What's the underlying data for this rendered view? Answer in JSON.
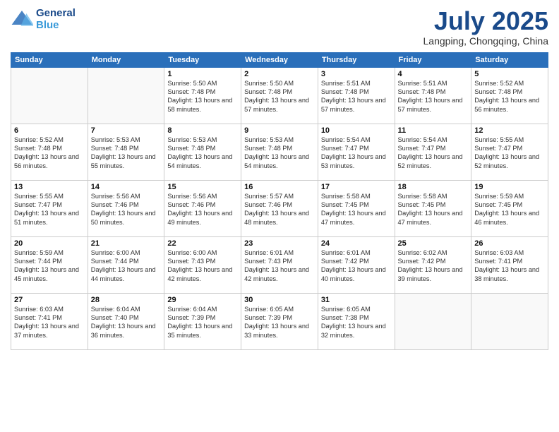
{
  "logo": {
    "line1": "General",
    "line2": "Blue"
  },
  "title": "July 2025",
  "subtitle": "Langping, Chongqing, China",
  "days_of_week": [
    "Sunday",
    "Monday",
    "Tuesday",
    "Wednesday",
    "Thursday",
    "Friday",
    "Saturday"
  ],
  "weeks": [
    [
      {
        "num": "",
        "info": ""
      },
      {
        "num": "",
        "info": ""
      },
      {
        "num": "1",
        "info": "Sunrise: 5:50 AM\nSunset: 7:48 PM\nDaylight: 13 hours and 58 minutes."
      },
      {
        "num": "2",
        "info": "Sunrise: 5:50 AM\nSunset: 7:48 PM\nDaylight: 13 hours and 57 minutes."
      },
      {
        "num": "3",
        "info": "Sunrise: 5:51 AM\nSunset: 7:48 PM\nDaylight: 13 hours and 57 minutes."
      },
      {
        "num": "4",
        "info": "Sunrise: 5:51 AM\nSunset: 7:48 PM\nDaylight: 13 hours and 57 minutes."
      },
      {
        "num": "5",
        "info": "Sunrise: 5:52 AM\nSunset: 7:48 PM\nDaylight: 13 hours and 56 minutes."
      }
    ],
    [
      {
        "num": "6",
        "info": "Sunrise: 5:52 AM\nSunset: 7:48 PM\nDaylight: 13 hours and 56 minutes."
      },
      {
        "num": "7",
        "info": "Sunrise: 5:53 AM\nSunset: 7:48 PM\nDaylight: 13 hours and 55 minutes."
      },
      {
        "num": "8",
        "info": "Sunrise: 5:53 AM\nSunset: 7:48 PM\nDaylight: 13 hours and 54 minutes."
      },
      {
        "num": "9",
        "info": "Sunrise: 5:53 AM\nSunset: 7:48 PM\nDaylight: 13 hours and 54 minutes."
      },
      {
        "num": "10",
        "info": "Sunrise: 5:54 AM\nSunset: 7:47 PM\nDaylight: 13 hours and 53 minutes."
      },
      {
        "num": "11",
        "info": "Sunrise: 5:54 AM\nSunset: 7:47 PM\nDaylight: 13 hours and 52 minutes."
      },
      {
        "num": "12",
        "info": "Sunrise: 5:55 AM\nSunset: 7:47 PM\nDaylight: 13 hours and 52 minutes."
      }
    ],
    [
      {
        "num": "13",
        "info": "Sunrise: 5:55 AM\nSunset: 7:47 PM\nDaylight: 13 hours and 51 minutes."
      },
      {
        "num": "14",
        "info": "Sunrise: 5:56 AM\nSunset: 7:46 PM\nDaylight: 13 hours and 50 minutes."
      },
      {
        "num": "15",
        "info": "Sunrise: 5:56 AM\nSunset: 7:46 PM\nDaylight: 13 hours and 49 minutes."
      },
      {
        "num": "16",
        "info": "Sunrise: 5:57 AM\nSunset: 7:46 PM\nDaylight: 13 hours and 48 minutes."
      },
      {
        "num": "17",
        "info": "Sunrise: 5:58 AM\nSunset: 7:45 PM\nDaylight: 13 hours and 47 minutes."
      },
      {
        "num": "18",
        "info": "Sunrise: 5:58 AM\nSunset: 7:45 PM\nDaylight: 13 hours and 47 minutes."
      },
      {
        "num": "19",
        "info": "Sunrise: 5:59 AM\nSunset: 7:45 PM\nDaylight: 13 hours and 46 minutes."
      }
    ],
    [
      {
        "num": "20",
        "info": "Sunrise: 5:59 AM\nSunset: 7:44 PM\nDaylight: 13 hours and 45 minutes."
      },
      {
        "num": "21",
        "info": "Sunrise: 6:00 AM\nSunset: 7:44 PM\nDaylight: 13 hours and 44 minutes."
      },
      {
        "num": "22",
        "info": "Sunrise: 6:00 AM\nSunset: 7:43 PM\nDaylight: 13 hours and 42 minutes."
      },
      {
        "num": "23",
        "info": "Sunrise: 6:01 AM\nSunset: 7:43 PM\nDaylight: 13 hours and 42 minutes."
      },
      {
        "num": "24",
        "info": "Sunrise: 6:01 AM\nSunset: 7:42 PM\nDaylight: 13 hours and 40 minutes."
      },
      {
        "num": "25",
        "info": "Sunrise: 6:02 AM\nSunset: 7:42 PM\nDaylight: 13 hours and 39 minutes."
      },
      {
        "num": "26",
        "info": "Sunrise: 6:03 AM\nSunset: 7:41 PM\nDaylight: 13 hours and 38 minutes."
      }
    ],
    [
      {
        "num": "27",
        "info": "Sunrise: 6:03 AM\nSunset: 7:41 PM\nDaylight: 13 hours and 37 minutes."
      },
      {
        "num": "28",
        "info": "Sunrise: 6:04 AM\nSunset: 7:40 PM\nDaylight: 13 hours and 36 minutes."
      },
      {
        "num": "29",
        "info": "Sunrise: 6:04 AM\nSunset: 7:39 PM\nDaylight: 13 hours and 35 minutes."
      },
      {
        "num": "30",
        "info": "Sunrise: 6:05 AM\nSunset: 7:39 PM\nDaylight: 13 hours and 33 minutes."
      },
      {
        "num": "31",
        "info": "Sunrise: 6:05 AM\nSunset: 7:38 PM\nDaylight: 13 hours and 32 minutes."
      },
      {
        "num": "",
        "info": ""
      },
      {
        "num": "",
        "info": ""
      }
    ]
  ]
}
